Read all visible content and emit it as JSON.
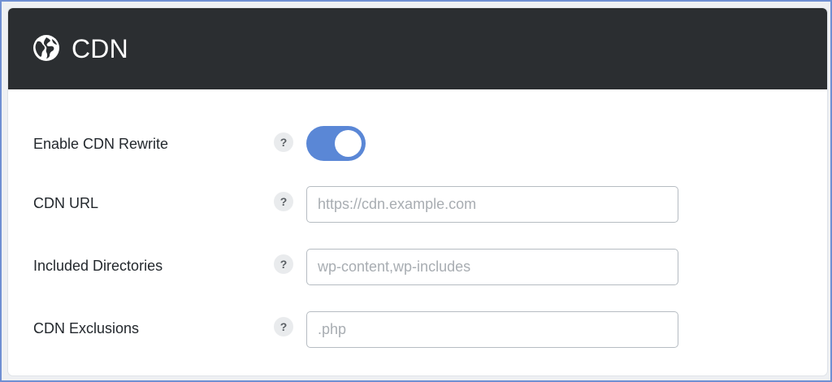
{
  "header": {
    "title": "CDN",
    "icon": "globe-icon"
  },
  "rows": [
    {
      "label": "Enable CDN Rewrite",
      "help": "?",
      "control": "toggle",
      "enabled": true
    },
    {
      "label": "CDN URL",
      "help": "?",
      "placeholder": "https://cdn.example.com",
      "value": ""
    },
    {
      "label": "Included Directories",
      "help": "?",
      "placeholder": "wp-content,wp-includes",
      "value": ""
    },
    {
      "label": "CDN Exclusions",
      "help": "?",
      "placeholder": ".php",
      "value": ""
    }
  ],
  "colors": {
    "header_bg": "#2b2e31",
    "toggle_on": "#5a87d6",
    "frame_border": "#6f8fd3"
  }
}
